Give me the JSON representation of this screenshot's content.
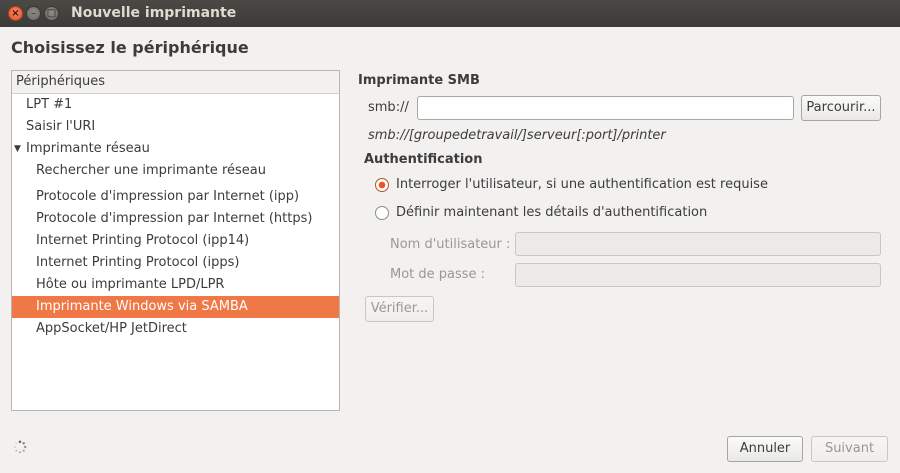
{
  "window": {
    "title": "Nouvelle imprimante"
  },
  "heading": "Choisissez le périphérique",
  "devices": {
    "header": "Périphériques",
    "items": [
      {
        "label": "LPT #1"
      },
      {
        "label": "Saisir l'URI"
      },
      {
        "label": "Imprimante réseau"
      },
      {
        "label": "Rechercher une imprimante réseau"
      },
      {
        "label": "Protocole d'impression par Internet (ipp)"
      },
      {
        "label": "Protocole d'impression par Internet (https)"
      },
      {
        "label": "Internet Printing Protocol (ipp14)"
      },
      {
        "label": "Internet Printing Protocol (ipps)"
      },
      {
        "label": "Hôte ou imprimante LPD/LPR"
      },
      {
        "label": "Imprimante Windows via SAMBA"
      },
      {
        "label": "AppSocket/HP JetDirect"
      }
    ],
    "selected": "Imprimante Windows via SAMBA"
  },
  "smb": {
    "section_title": "Imprimante SMB",
    "prefix_label": "smb://",
    "value": "",
    "browse_label": "Parcourir...",
    "hint": "smb://[groupedetravail/]serveur[:port]/printer"
  },
  "auth": {
    "title": "Authentification",
    "option_prompt": "Interroger l'utilisateur, si une authentification est requise",
    "option_now": "Définir maintenant les détails d'authentification",
    "selected_option": "Interroger l'utilisateur, si une authentification est requise",
    "username_label": "Nom d'utilisateur :",
    "password_label": "Mot de passe :",
    "username_value": "",
    "password_value": "",
    "verify_label": "Vérifier..."
  },
  "footer": {
    "cancel_label": "Annuler",
    "next_label": "Suivant"
  },
  "colors": {
    "selection": "#f07746",
    "titlebar": "#3c3b37",
    "close_button": "#e0502a"
  }
}
